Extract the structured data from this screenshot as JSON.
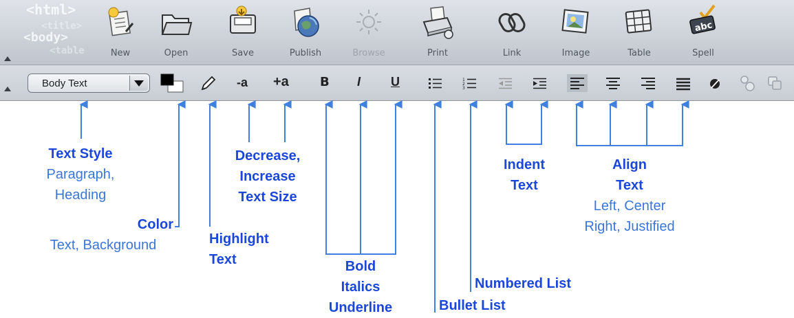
{
  "toolbar": {
    "logo_lines": [
      "<html>",
      "<title>",
      "<body>",
      "<table"
    ],
    "buttons": [
      {
        "label": "New",
        "icon": "new-document-icon",
        "disabled": false
      },
      {
        "label": "Open",
        "icon": "folder-icon",
        "disabled": false
      },
      {
        "label": "Save",
        "icon": "save-icon",
        "disabled": false
      },
      {
        "label": "Publish",
        "icon": "globe-publish-icon",
        "disabled": false
      },
      {
        "label": "Browse",
        "icon": "browse-icon",
        "disabled": true
      },
      {
        "label": "Print",
        "icon": "printer-icon",
        "disabled": false
      },
      {
        "label": "Link",
        "icon": "chain-link-icon",
        "disabled": false
      },
      {
        "label": "Image",
        "icon": "picture-icon",
        "disabled": false
      },
      {
        "label": "Table",
        "icon": "table-icon",
        "disabled": false
      },
      {
        "label": "Spell",
        "icon": "spellcheck-icon",
        "disabled": false
      }
    ]
  },
  "format_bar": {
    "style_select": {
      "value": "Body Text"
    },
    "decrease_size_label": "-a",
    "increase_size_label": "+a",
    "bold_label": "B",
    "italic_label": "I",
    "underline_label": "U"
  },
  "annotations": {
    "text_style": {
      "title": "Text Style",
      "lines": [
        "Paragraph,",
        "Heading"
      ]
    },
    "color": {
      "title": "Color",
      "lines": [
        "Text, Background"
      ]
    },
    "highlight": {
      "title_lines": [
        "Highlight",
        "Text"
      ]
    },
    "text_size": {
      "title_lines": [
        "Decrease,",
        "Increase",
        "Text Size"
      ]
    },
    "bold_italics_underline": {
      "title_lines": [
        "Bold",
        "Italics",
        "Underline"
      ]
    },
    "bullet_list": {
      "title": "Bullet List"
    },
    "numbered_list": {
      "title": "Numbered List"
    },
    "indent": {
      "title_lines": [
        "Indent",
        "Text"
      ]
    },
    "align": {
      "title_lines": [
        "Align",
        "Text"
      ],
      "lines": [
        "Left, Center",
        "Right, Justified"
      ]
    }
  },
  "colors": {
    "annotation_title": "#1a47d9",
    "annotation_text": "#3a76d8",
    "arrow": "#3f7fe0"
  }
}
